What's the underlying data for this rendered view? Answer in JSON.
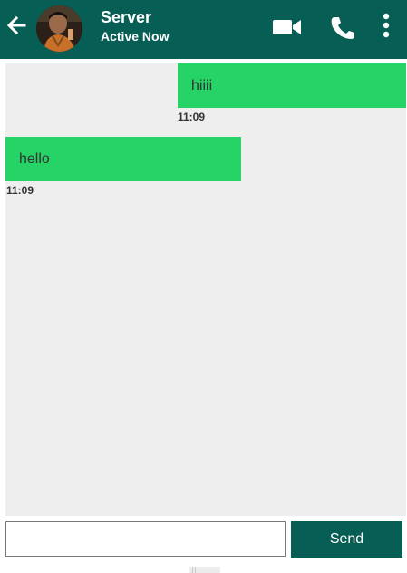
{
  "header": {
    "title": "Server",
    "status": "Active Now",
    "background_color": "#075e54",
    "icons": {
      "back": "arrow-left-icon",
      "video": "video-camera-icon",
      "call": "phone-icon",
      "menu": "more-vert-icon"
    }
  },
  "messages": [
    {
      "text": "hiiii",
      "time": "11:09",
      "side": "right"
    },
    {
      "text": "hello",
      "time": "11:09",
      "side": "left"
    }
  ],
  "composer": {
    "input_value": "",
    "send_label": "Send"
  },
  "colors": {
    "bubble": "#25d366",
    "chat_background": "#eeeeee",
    "accent": "#075e54"
  }
}
